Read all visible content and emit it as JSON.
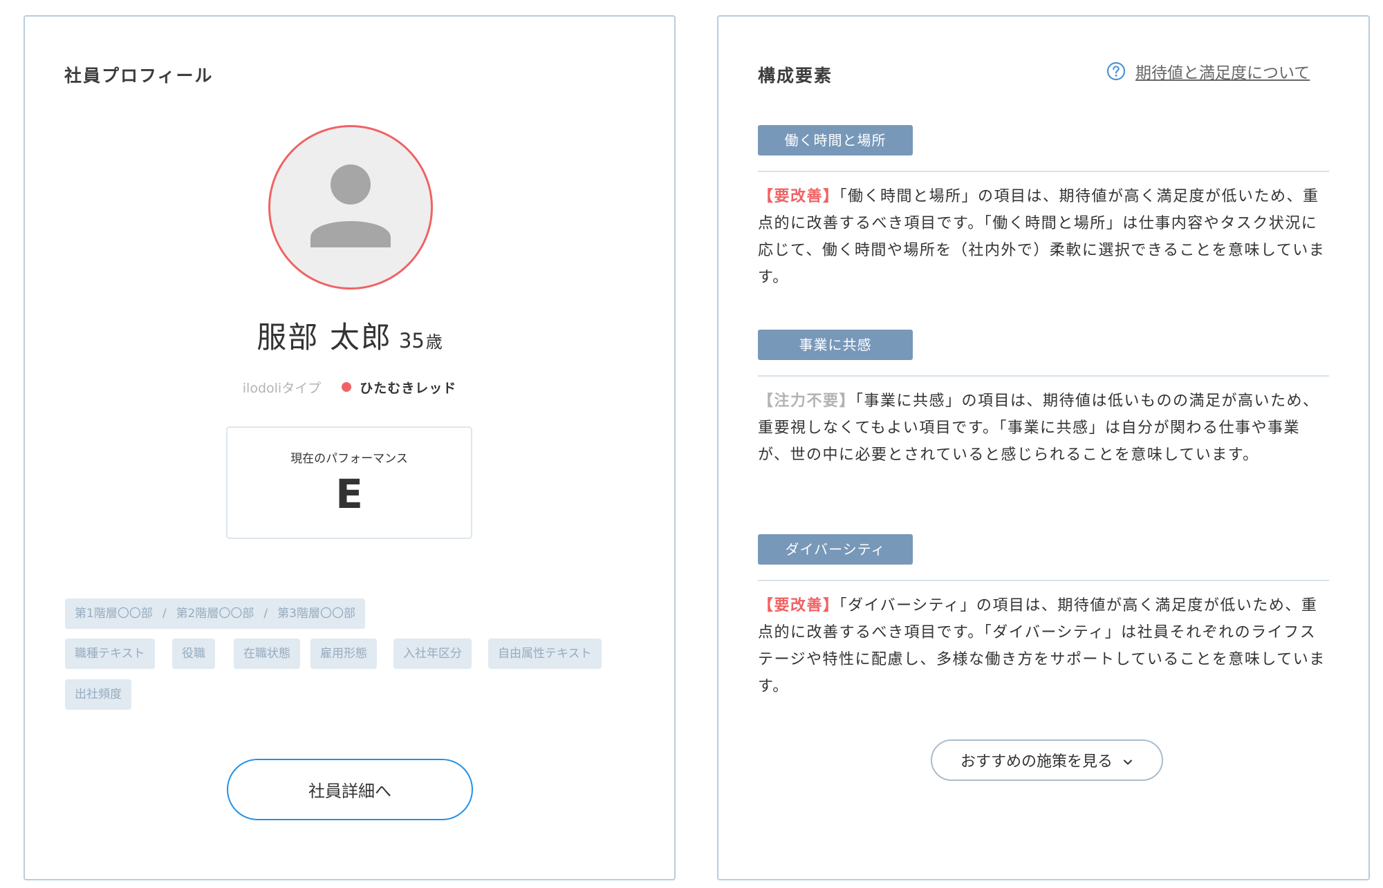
{
  "profile": {
    "title": "社員プロフィール",
    "name": "服部 太郎",
    "age": "35",
    "age_unit": "歳",
    "type_label": "ilodoliタイプ",
    "type_value": "ひたむきレッド",
    "type_color": "#f06264",
    "performance_label": "現在のパフォーマンス",
    "performance_value": "E",
    "department_path": [
      "第1階層〇〇部",
      "第2階層〇〇部",
      "第3階層〇〇部"
    ],
    "path_separator": "/",
    "tags": [
      "職種テキスト",
      "役職",
      "在職状態",
      "雇用形態",
      "入社年区分",
      "自由属性テキスト",
      "出社頻度"
    ],
    "detail_button": "社員詳細へ"
  },
  "factors": {
    "title": "構成要素",
    "help_link": "期待値と満足度について",
    "items": [
      {
        "name": "働く時間と場所",
        "status": "【要改善】",
        "status_color": "#f06264",
        "description": "「働く時間と場所」の項目は、期待値が高く満足度が低いため、重点的に改善するべき項目です。「働く時間と場所」は仕事内容やタスク状況に応じて、働く時間や場所を（社内外で）柔軟に選択できることを意味しています。"
      },
      {
        "name": "事業に共感",
        "status": "【注力不要】",
        "status_color": "#b3b3b3",
        "description": "「事業に共感」の項目は、期待値は低いものの満足が高いため、重要視しなくてもよい項目です。「事業に共感」は自分が関わる仕事や事業が、世の中に必要とされていると感じられることを意味しています。"
      },
      {
        "name": "ダイバーシティ",
        "status": "【要改善】",
        "status_color": "#f06264",
        "description": "「ダイバーシティ」の項目は、期待値が高く満足度が低いため、重点的に改善するべき項目です。「ダイバーシティ」は社員それぞれのライフステージや特性に配慮し、多様な働き方をサポートしていることを意味しています。"
      }
    ],
    "recommend_button": "おすすめの施策を見る"
  },
  "icons": {
    "avatar": "person-placeholder-icon",
    "help": "question-circle-icon",
    "chevron": "chevron-down-icon"
  },
  "colors": {
    "accent_red": "#f06264",
    "button_blue": "#2590e4",
    "badge_blue": "#7898b9",
    "card_border": "#b7cddb"
  }
}
